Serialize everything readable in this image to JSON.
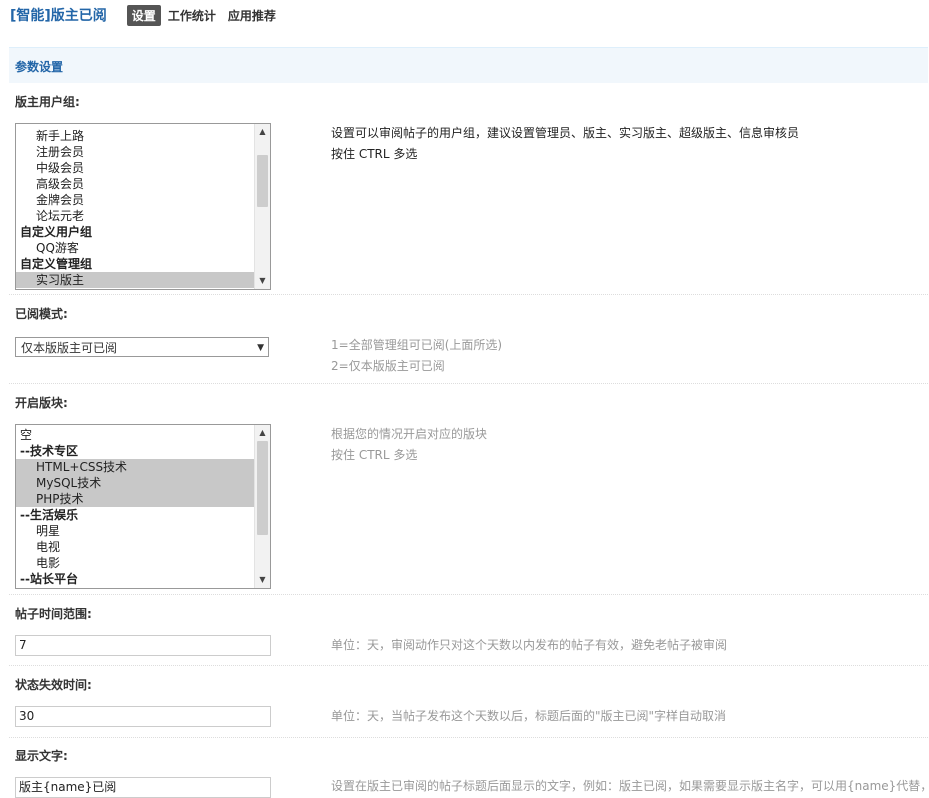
{
  "header": {
    "app_title": "[智能]版主已阅",
    "tabs": [
      {
        "label": "设置",
        "active": true
      },
      {
        "label": "工作统计",
        "active": false
      },
      {
        "label": "应用推荐",
        "active": false
      }
    ]
  },
  "section_title": "参数设置",
  "moderator_groups": {
    "label": "版主用户组:",
    "options": [
      {
        "text": "新手上路",
        "indent": true,
        "selected": false
      },
      {
        "text": "注册会员",
        "indent": true,
        "selected": false
      },
      {
        "text": "中级会员",
        "indent": true,
        "selected": false
      },
      {
        "text": "高级会员",
        "indent": true,
        "selected": false
      },
      {
        "text": "金牌会员",
        "indent": true,
        "selected": false
      },
      {
        "text": "论坛元老",
        "indent": true,
        "selected": false
      },
      {
        "text": "自定义用户组",
        "group": true,
        "selected": false
      },
      {
        "text": "QQ游客",
        "indent": true,
        "selected": false
      },
      {
        "text": "自定义管理组",
        "group": true,
        "selected": false
      },
      {
        "text": "实习版主",
        "indent": true,
        "selected": true
      }
    ],
    "tip_lines": [
      "设置可以审阅帖子的用户组，建议设置管理员、版主、实习版主、超级版主、信息审核员",
      "按住 CTRL 多选"
    ]
  },
  "read_mode": {
    "label": "已阅模式:",
    "value": "仅本版版主可已阅",
    "tip_lines": [
      "1=全部管理组可已阅(上面所选)",
      "2=仅本版版主可已阅"
    ]
  },
  "forums": {
    "label": "开启版块:",
    "options": [
      {
        "text": "空",
        "selected": false
      },
      {
        "text": "--技术专区",
        "group": true,
        "selected": false
      },
      {
        "text": "HTML+CSS技术",
        "indent": true,
        "selected": true
      },
      {
        "text": "MySQL技术",
        "indent": true,
        "selected": true
      },
      {
        "text": "PHP技术",
        "indent": true,
        "selected": true
      },
      {
        "text": "--生活娱乐",
        "group": true,
        "selected": false
      },
      {
        "text": "明星",
        "indent": true,
        "selected": false
      },
      {
        "text": "电视",
        "indent": true,
        "selected": false
      },
      {
        "text": "电影",
        "indent": true,
        "selected": false
      },
      {
        "text": "--站长平台",
        "group": true,
        "selected": false
      }
    ],
    "tip_lines": [
      "根据您的情况开启对应的版块",
      "按住 CTRL 多选"
    ]
  },
  "time_range": {
    "label": "帖子时间范围:",
    "value": "7",
    "tip": "单位：天，审阅动作只对这个天数以内发布的帖子有效，避免老帖子被审阅"
  },
  "expire": {
    "label": "状态失效时间:",
    "value": "30",
    "tip": "单位：天，当帖子发布这个天数以后，标题后面的\"版主已阅\"字样自动取消"
  },
  "display_text": {
    "label": "显示文字:",
    "value": "版主{name}已阅",
    "tip": "设置在版主已审阅的帖子标题后面显示的文字，例如：版主已阅，如果需要显示版主名字，可以用{name}代替，"
  }
}
